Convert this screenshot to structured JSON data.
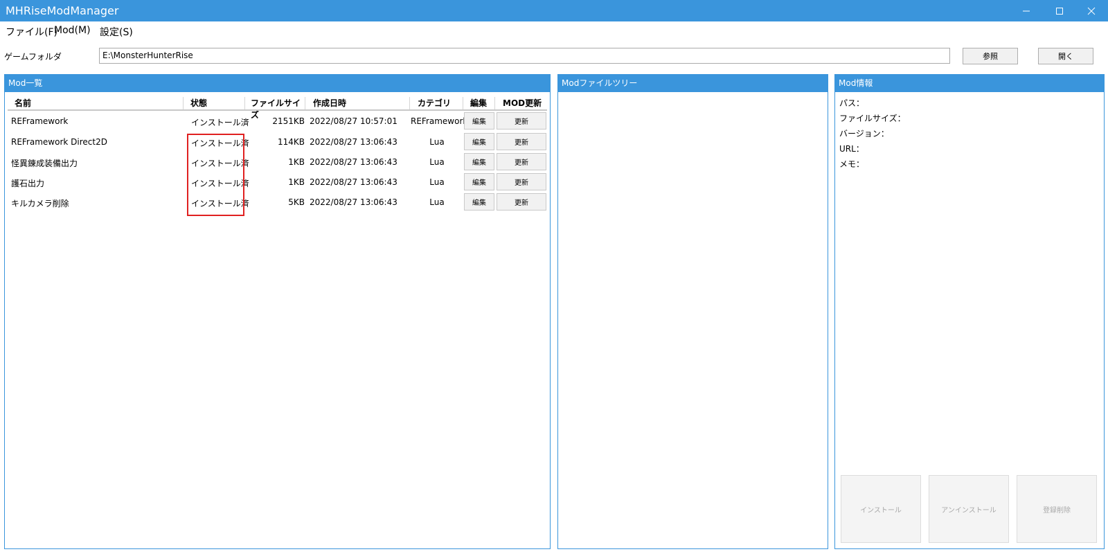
{
  "window": {
    "title": "MHRiseModManager"
  },
  "menu": {
    "file": "ファイル(F)",
    "mod": "Mod(M)",
    "settings": "設定(S)"
  },
  "game_folder": {
    "label": "ゲームフォルダ",
    "value": "E:\\MonsterHunterRise",
    "browse": "参照",
    "open": "開く"
  },
  "mod_list": {
    "title": "Mod一覧",
    "columns": {
      "name": "名前",
      "status": "状態",
      "size": "ファイルサイズ",
      "date": "作成日時",
      "category": "カテゴリ",
      "edit": "編集",
      "update": "MOD更新"
    },
    "rows": [
      {
        "name": "REFramework",
        "status": "インストール済",
        "size": "2151KB",
        "date": "2022/08/27 10:57:01",
        "category": "REFramework",
        "edit": "編集",
        "update": "更新"
      },
      {
        "name": "REFramework Direct2D",
        "status": "インストール済",
        "size": "114KB",
        "date": "2022/08/27 13:06:43",
        "category": "Lua",
        "edit": "編集",
        "update": "更新"
      },
      {
        "name": "怪異錬成装備出力",
        "status": "インストール済",
        "size": "1KB",
        "date": "2022/08/27 13:06:43",
        "category": "Lua",
        "edit": "編集",
        "update": "更新"
      },
      {
        "name": "護石出力",
        "status": "インストール済",
        "size": "1KB",
        "date": "2022/08/27 13:06:43",
        "category": "Lua",
        "edit": "編集",
        "update": "更新"
      },
      {
        "name": "キルカメラ削除",
        "status": "インストール済",
        "size": "5KB",
        "date": "2022/08/27 13:06:43",
        "category": "Lua",
        "edit": "編集",
        "update": "更新"
      }
    ]
  },
  "file_tree": {
    "title": "Modファイルツリー"
  },
  "mod_info": {
    "title": "Mod情報",
    "path_label": "パス：",
    "size_label": "ファイルサイズ：",
    "version_label": "バージョン：",
    "url_label": "URL：",
    "memo_label": "メモ：",
    "install": "インストール",
    "uninstall": "アンインストール",
    "unregister": "登録削除"
  },
  "colors": {
    "accent": "#3a95dc",
    "highlight": "#e02020"
  }
}
